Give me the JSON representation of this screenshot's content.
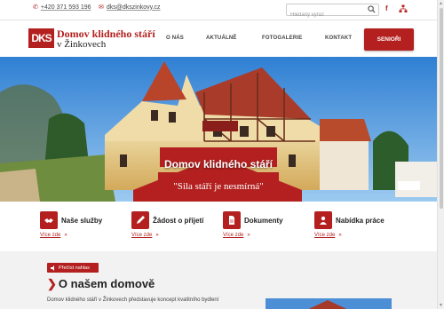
{
  "topbar": {
    "phone": "+420 371 593 196",
    "email": "dks@dkszinkovy.cz",
    "search_placeholder": "Hledaný výraz",
    "icons": {
      "phone": "phone-icon",
      "email": "envelope-icon",
      "search": "search-icon",
      "facebook": "facebook-icon",
      "sitemap": "sitemap-icon"
    }
  },
  "header": {
    "logo_mark": "DKS",
    "logo_line1": "Domov klidného stáří",
    "logo_line2": "v Žinkovech",
    "nav": [
      "O NÁS",
      "AKTUÁLNĚ",
      "FOTOGALERIE",
      "KONTAKT"
    ],
    "nav_button": "SENIOŘI"
  },
  "hero": {
    "title": "Domov klidného stáří",
    "subtitle": "\"Sila stáří je nesmírná\""
  },
  "services": [
    {
      "title": "Naše služby",
      "link": "Více zde",
      "icon": "handshake-icon"
    },
    {
      "title": "Žádost o přijetí",
      "link": "Více zde",
      "icon": "pencil-icon"
    },
    {
      "title": "Dokumenty",
      "link": "Více zde",
      "icon": "document-icon"
    },
    {
      "title": "Nabídka práce",
      "link": "Více zde",
      "icon": "worker-icon"
    }
  ],
  "about": {
    "read_button": "Přečíst nahlas",
    "title": "O našem domově",
    "text": "Domov klidného stáří v Žinkovech představuje koncept kvalitního bydlení"
  },
  "colors": {
    "accent": "#b3201f",
    "about_bg": "#f2f2f2"
  }
}
